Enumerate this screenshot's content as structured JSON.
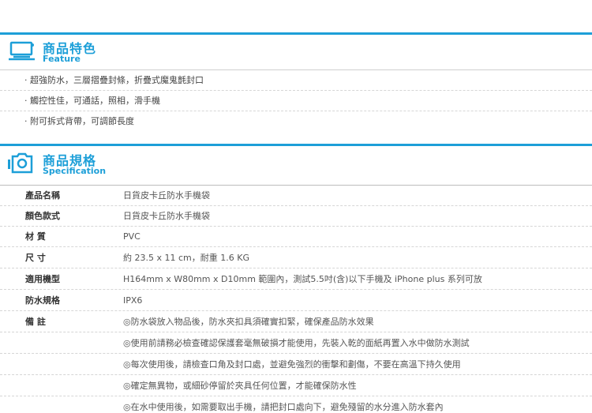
{
  "feature_section": {
    "title": "商品特色",
    "subtitle": "Feature",
    "icon": "monitor-icon",
    "items": [
      "超強防水，三層摺疊封條，折疊式魔鬼氈封口",
      "觸控性佳，可通話，照相，滑手機",
      "附可拆式背帶，可調節長度"
    ]
  },
  "spec_section": {
    "title": "商品規格",
    "subtitle": "Specification",
    "icon": "camera-icon",
    "rows": [
      {
        "label": "產品名稱",
        "value": "日貨皮卡丘防水手機袋"
      },
      {
        "label": "顏色款式",
        "value": "日貨皮卡丘防水手機袋"
      },
      {
        "label": "材 質",
        "value": "PVC"
      },
      {
        "label": "尺 寸",
        "value": "約 23.5 x 11 cm，耐重 1.6 KG"
      },
      {
        "label": "適用機型",
        "value": "H164mm x W80mm x D10mm 範圍內，測試5.5吋(含)以下手機及 iPhone plus 系列可放"
      },
      {
        "label": "防水規格",
        "value": "IPX6"
      },
      {
        "label": "備 註",
        "value": "◎防水袋放入物品後，防水夾扣具須確實扣緊，確保產品防水效果"
      }
    ],
    "notes": [
      "◎使用前請務必檢查確認保護套毫無破損才能使用，先裝入乾的面紙再置入水中做防水測試",
      "◎每次使用後，請檢查口角及封口處，並避免強烈的衝擊和劃傷，不要在高溫下持久使用",
      "◎確定無異物，或細砂停留於夾具任何位置，才能確保防水性",
      "◎在水中使用後，如需要取出手機，請把封口處向下，避免殘留的水分進入防水套內"
    ]
  },
  "colors": {
    "accent": "#1d9fd8",
    "divider": "#d6d6d6"
  }
}
